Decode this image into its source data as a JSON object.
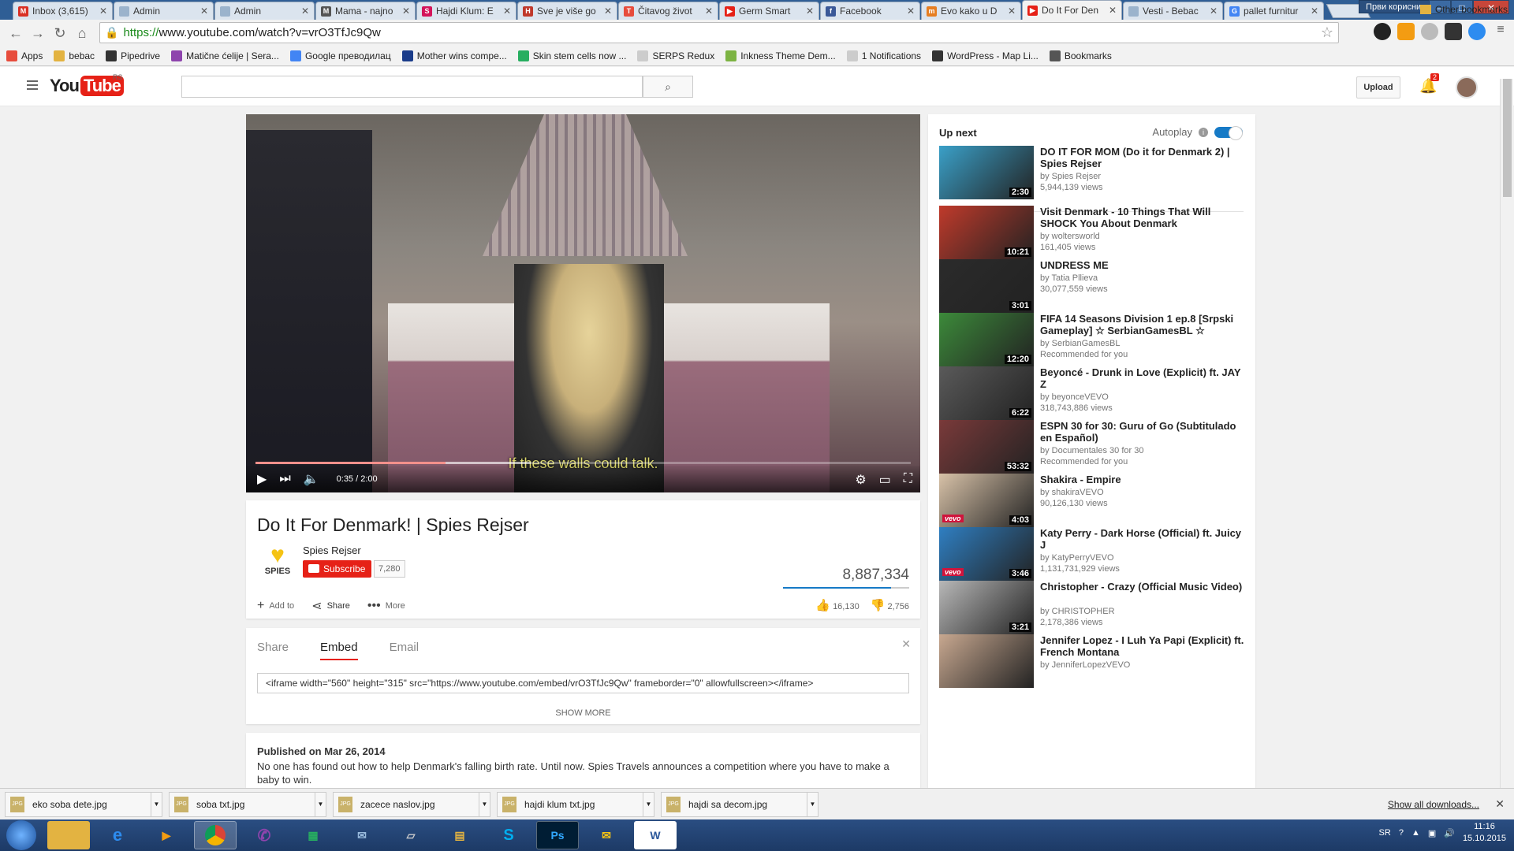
{
  "browser": {
    "tabs": [
      {
        "title": "Inbox (3,615)",
        "color": "#d93025",
        "glyph": "M"
      },
      {
        "title": "Admin",
        "color": "#9bb3cc",
        "glyph": ""
      },
      {
        "title": "Admin",
        "color": "#9bb3cc",
        "glyph": ""
      },
      {
        "title": "Mama - najno",
        "color": "#555555",
        "glyph": "M"
      },
      {
        "title": "Hajdi Klum: E",
        "color": "#d4145a",
        "glyph": "S"
      },
      {
        "title": "Sve je više go",
        "color": "#c0392b",
        "glyph": "H"
      },
      {
        "title": "Čitavog život",
        "color": "#e74c3c",
        "glyph": "T"
      },
      {
        "title": "Germ Smart",
        "color": "#e62117",
        "glyph": "▶"
      },
      {
        "title": "Facebook",
        "color": "#3b5998",
        "glyph": "f"
      },
      {
        "title": "Evo kako u D",
        "color": "#e67e22",
        "glyph": "m"
      },
      {
        "title": "Do It For Den",
        "color": "#e62117",
        "glyph": "▶",
        "active": true
      },
      {
        "title": "Vesti - Bebac",
        "color": "#9bb3cc",
        "glyph": ""
      },
      {
        "title": "pallet furnitur",
        "color": "#4285f4",
        "glyph": "G"
      }
    ],
    "profile": "Први корисник",
    "url_scheme": "https://",
    "url_rest": "www.youtube.com/watch?v=vrO3TfJc9Qw",
    "bookmarks": [
      {
        "label": "Apps",
        "color": "#e74c3c"
      },
      {
        "label": "bebac",
        "color": "#e3b341"
      },
      {
        "label": "Pipedrive",
        "color": "#333333"
      },
      {
        "label": "Matične ćelije | Sera...",
        "color": "#8e44ad"
      },
      {
        "label": "Google преводилац",
        "color": "#4285f4"
      },
      {
        "label": "Mother wins compe...",
        "color": "#1a3c8a"
      },
      {
        "label": "Skin stem cells now ...",
        "color": "#27ae60"
      },
      {
        "label": "SERPS Redux",
        "color": "#cccccc"
      },
      {
        "label": "Inkness Theme Dem...",
        "color": "#7cb342"
      },
      {
        "label": "1 Notifications",
        "color": "#cccccc"
      },
      {
        "label": "WordPress - Map Li...",
        "color": "#333333"
      },
      {
        "label": "Bookmarks",
        "color": "#555555"
      }
    ],
    "other_bookmarks": "Other bookmarks"
  },
  "youtube": {
    "logo_you": "You",
    "logo_tube": "Tube",
    "country": "RS",
    "upload_label": "Upload",
    "notification_count": "2",
    "video": {
      "subtitle": "If these walls could talk.",
      "time": "0:35 / 2:00",
      "progress_played": 0.29,
      "progress_loaded": 0.42,
      "title": "Do It For Denmark! | Spies Rejser",
      "channel": "Spies Rejser",
      "channel_logo_text": "SPIES",
      "subscribe_label": "Subscribe",
      "subscriber_count": "7,280",
      "views": "8,887,334",
      "like_ratio": 0.854,
      "add_to": "Add to",
      "share": "Share",
      "more": "More",
      "likes": "16,130",
      "dislikes": "2,756"
    },
    "share_panel": {
      "tabs": [
        "Share",
        "Embed",
        "Email"
      ],
      "active_tab": 1,
      "embed_code": "<iframe width=\"560\" height=\"315\" src=\"https://www.youtube.com/embed/vrO3TfJc9Qw\" frameborder=\"0\" allowfullscreen></iframe>",
      "show_more": "SHOW MORE"
    },
    "description": {
      "published": "Published on Mar 26, 2014",
      "text": "No one has found out how to help Denmark's falling birth rate. Until now. Spies Travels announces a competition where you have to make a baby to win."
    },
    "sidebar": {
      "up_next": "Up next",
      "autoplay": "Autoplay",
      "videos": [
        {
          "title": "DO IT FOR MOM (Do it for Denmark 2) | Spies Rejser",
          "by": "by Spies Rejser",
          "views": "5,944,139 views",
          "duration": "2:30",
          "thumb": "#3aa0c8",
          "vevo": ""
        },
        {
          "title": "Visit Denmark - 10 Things That Will SHOCK You About Denmark",
          "by": "by woltersworld",
          "views": "161,405 views",
          "duration": "10:21",
          "thumb": "#c03a2b",
          "vevo": ""
        },
        {
          "title": "UNDRESS ME",
          "by": "by Tatia Pllieva",
          "views": "30,077,559 views",
          "duration": "3:01",
          "thumb": "#2b2b2b",
          "vevo": ""
        },
        {
          "title": "FIFA 14 Seasons Division 1 ep.8 [Srpski Gameplay] ☆ SerbianGamesBL ☆",
          "by": "by SerbianGamesBL",
          "views": "Recommended for you",
          "duration": "12:20",
          "thumb": "#3c8a3a",
          "vevo": ""
        },
        {
          "title": "Beyoncé - Drunk in Love (Explicit) ft. JAY Z",
          "by": "by beyonceVEVO",
          "views": "318,743,886 views",
          "duration": "6:22",
          "thumb": "#5a5a5a",
          "vevo": ""
        },
        {
          "title": "ESPN 30 for 30: Guru of Go (Subtitulado en Español)",
          "by": "by Documentales 30 for 30",
          "views": "Recommended for you",
          "duration": "53:32",
          "thumb": "#7a3a3a",
          "vevo": ""
        },
        {
          "title": "Shakira - Empire",
          "by": "by shakiraVEVO",
          "views": "90,126,130 views",
          "duration": "4:03",
          "thumb": "#d8c2a8",
          "vevo": "vevo"
        },
        {
          "title": "Katy Perry - Dark Horse (Official) ft. Juicy J",
          "by": "by KatyPerryVEVO",
          "views": "1,131,731,929 views",
          "duration": "3:46",
          "thumb": "#2f7fc2",
          "vevo": "vevo"
        },
        {
          "title": "Christopher - Crazy (Official Music Video)",
          "by": "by CHRISTOPHER",
          "views": "2,178,386 views",
          "duration": "3:21",
          "thumb": "#b8b8b8",
          "vevo": ""
        },
        {
          "title": "Jennifer Lopez - I Luh Ya Papi (Explicit) ft. French Montana",
          "by": "by JenniferLopezVEVO",
          "views": "",
          "duration": "",
          "thumb": "#c8a890",
          "vevo": ""
        }
      ]
    }
  },
  "downloads": {
    "items": [
      "eko soba dete.jpg",
      "soba txt.jpg",
      "zacece naslov.jpg",
      "hajdi klum txt.jpg",
      "hajdi sa decom.jpg"
    ],
    "show_all": "Show all downloads..."
  },
  "taskbar": {
    "lang": "SR",
    "time": "11:16",
    "date": "15.10.2015"
  }
}
